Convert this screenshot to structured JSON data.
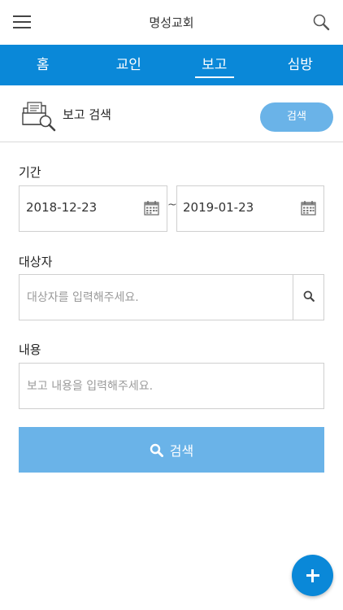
{
  "header": {
    "title": "명성교회",
    "menu_icon": "hamburger-icon",
    "search_icon": "search-icon"
  },
  "nav": {
    "tabs": [
      {
        "label": "홈"
      },
      {
        "label": "교인"
      },
      {
        "label": "보고",
        "active": true
      },
      {
        "label": "심방"
      }
    ]
  },
  "section": {
    "icon": "report-search-icon",
    "title": "보고 검색",
    "search_button": "검색"
  },
  "form": {
    "period": {
      "label": "기간",
      "start_date": "2018-12-23",
      "separator": "~",
      "end_date": "2019-01-23"
    },
    "target": {
      "label": "대상자",
      "placeholder": "대상자를 입력해주세요."
    },
    "content": {
      "label": "내용",
      "placeholder": "보고 내용을 입력해주세요."
    },
    "submit_label": "검색"
  },
  "fab": {
    "icon": "plus-icon"
  },
  "colors": {
    "primary": "#0a88d8",
    "button_light": "#6ab3e8",
    "border": "#cfcfcf"
  }
}
